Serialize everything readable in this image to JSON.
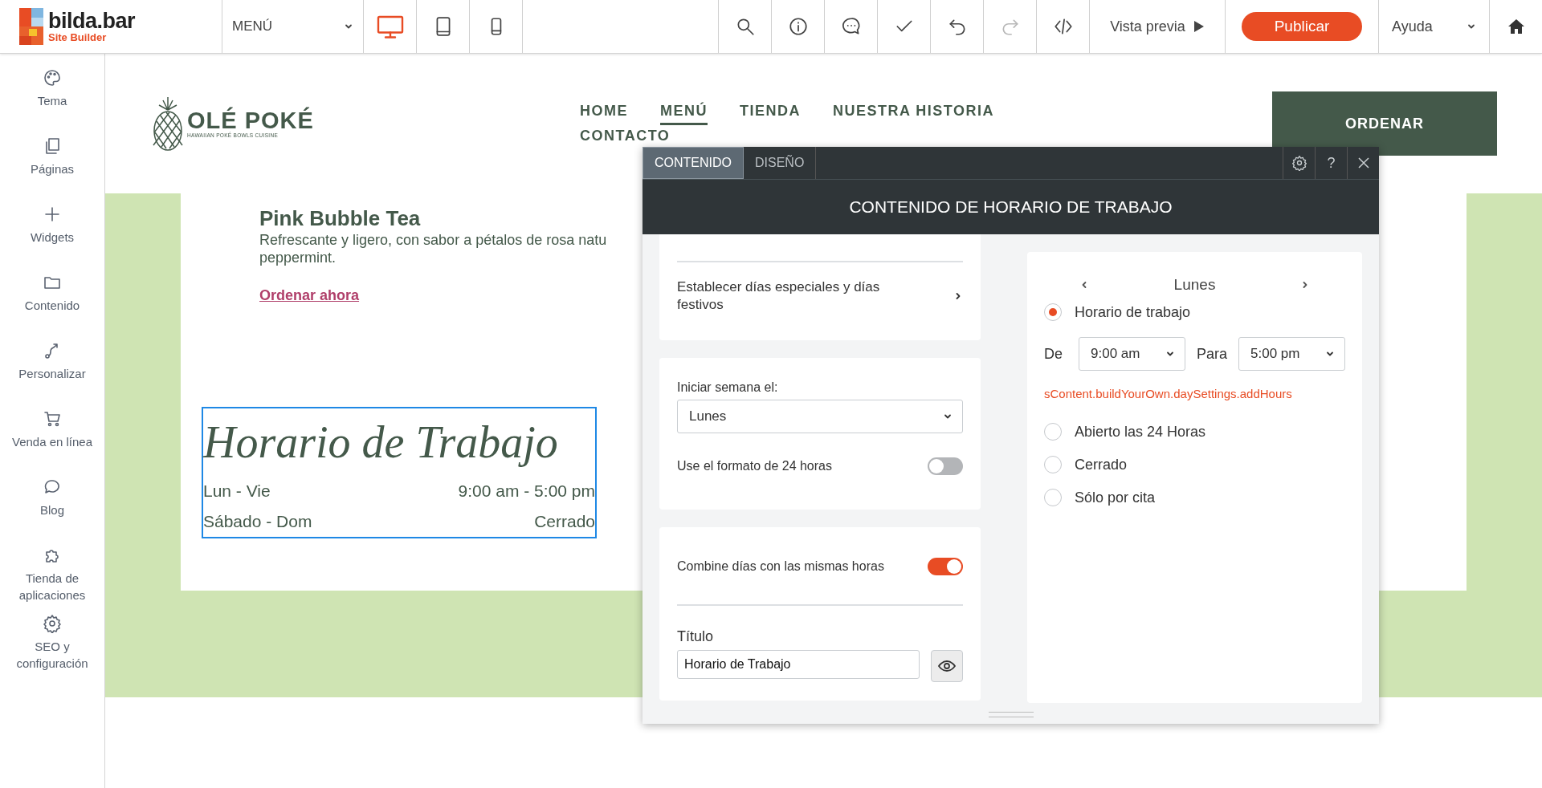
{
  "app": {
    "logo": {
      "name": "bilda.bar",
      "tagline": "Site Builder"
    },
    "page_select": "MENÚ",
    "devices": [
      {
        "kind": "desktop",
        "selected": true
      },
      {
        "kind": "tablet",
        "selected": false
      },
      {
        "kind": "phone",
        "selected": false
      }
    ],
    "tools": [
      {
        "kind": "search",
        "disabled": false
      },
      {
        "kind": "info",
        "disabled": false
      },
      {
        "kind": "chat",
        "disabled": false
      },
      {
        "kind": "check",
        "disabled": false
      },
      {
        "kind": "undo",
        "disabled": false
      },
      {
        "kind": "redo",
        "disabled": true
      },
      {
        "kind": "code",
        "disabled": false
      }
    ],
    "preview": "Vista previa",
    "publish": "Publicar",
    "help": "Ayuda"
  },
  "sidebar": {
    "items": [
      {
        "kind": "palette",
        "label": "Tema"
      },
      {
        "kind": "pages",
        "label": "Páginas"
      },
      {
        "kind": "plus",
        "label": "Widgets"
      },
      {
        "kind": "folder",
        "label": "Contenido"
      },
      {
        "kind": "path",
        "label": "Personalizar"
      },
      {
        "kind": "cart",
        "label": "Venda en línea"
      },
      {
        "kind": "bubble",
        "label": "Blog"
      },
      {
        "kind": "puzzle",
        "label": "Tienda de aplicaciones"
      },
      {
        "kind": "gear",
        "label": "SEO y configuración"
      }
    ]
  },
  "site": {
    "logo": {
      "name": "OLÉ POKÉ",
      "tagline": "HAWAIIAN POKÉ BOWLS CUISINE"
    },
    "nav": [
      {
        "label": "HOME",
        "selected": false
      },
      {
        "label": "MENÚ",
        "selected": true
      },
      {
        "label": "TIENDA",
        "selected": false
      },
      {
        "label": "NUESTRA HISTORIA",
        "selected": false
      },
      {
        "label": "CONTACTO",
        "selected": false
      }
    ],
    "order_button": "ORDENAR",
    "product": {
      "title": "Pink Bubble Tea",
      "description": [
        "Refrescante y ligero, con sabor a pétalos de rosa natu",
        "peppermint."
      ],
      "link": "Ordenar ahora"
    },
    "hours_widget": {
      "selected": true,
      "title": "Horario de Trabajo",
      "rows": [
        {
          "days": "Lun - Vie",
          "hours": "9:00 am - 5:00 pm"
        },
        {
          "days": "Sábado - Dom",
          "hours": "Cerrado"
        }
      ]
    }
  },
  "dialog": {
    "tabs": [
      {
        "label": "CONTENIDO",
        "selected": true
      },
      {
        "label": "DISEÑO",
        "selected": false
      }
    ],
    "help": "?",
    "title": "CONTENIDO DE HORARIO DE TRABAJO",
    "special_days": "Establecer días especiales y días festivos",
    "week_start": {
      "label": "Iniciar semana el:",
      "value": "Lunes"
    },
    "format_24h": {
      "label": "Use el formato de 24 horas",
      "on": false
    },
    "combine_days": {
      "label": "Combine días con las mismas horas",
      "on": true
    },
    "title_field": {
      "label": "Título",
      "value": "Horario de Trabajo"
    },
    "day_panel": {
      "day": "Lunes",
      "from_label": "De",
      "from": "9:00 am",
      "to_label": "Para",
      "to": "5:00 pm",
      "error": "sContent.buildYourOwn.daySettings.addHours",
      "options": [
        {
          "label": "Horario de trabajo",
          "selected": true
        },
        {
          "label": "Abierto las 24 Horas",
          "selected": false
        },
        {
          "label": "Cerrado",
          "selected": false
        },
        {
          "label": "Sólo por cita",
          "selected": false
        }
      ]
    }
  }
}
